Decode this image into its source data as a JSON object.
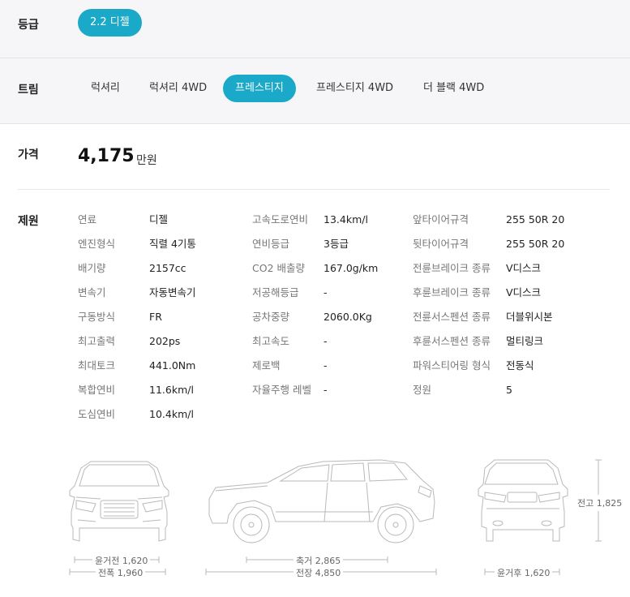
{
  "grade": {
    "label": "등급",
    "selected": "2.2 디젤"
  },
  "trim": {
    "label": "트림",
    "options": [
      "럭셔리",
      "럭셔리 4WD",
      "프레스티지",
      "프레스티지 4WD",
      "더 블랙 4WD"
    ],
    "selected": "프레스티지"
  },
  "price": {
    "label": "가격",
    "value": "4,175",
    "unit": "만원"
  },
  "specs": {
    "label": "제원",
    "col1": [
      {
        "key": "연료",
        "value": "디젤"
      },
      {
        "key": "엔진형식",
        "value": "직렬 4기통"
      },
      {
        "key": "배기량",
        "value": "2157cc"
      },
      {
        "key": "변속기",
        "value": "자동변속기"
      },
      {
        "key": "구동방식",
        "value": "FR"
      },
      {
        "key": "최고출력",
        "value": "202ps"
      },
      {
        "key": "최대토크",
        "value": "441.0Nm"
      },
      {
        "key": "복합연비",
        "value": "11.6km/l"
      },
      {
        "key": "도심연비",
        "value": "10.4km/l"
      }
    ],
    "col2": [
      {
        "key": "고속도로연비",
        "value": "13.4km/l"
      },
      {
        "key": "연비등급",
        "value": "3등급"
      },
      {
        "key": "CO2 배출량",
        "value": "167.0g/km"
      },
      {
        "key": "저공해등급",
        "value": "-"
      },
      {
        "key": "공차중량",
        "value": "2060.0Kg"
      },
      {
        "key": "최고속도",
        "value": "-"
      },
      {
        "key": "제로백",
        "value": "-"
      },
      {
        "key": "자율주행 레벨",
        "value": "-"
      }
    ],
    "col3": [
      {
        "key": "앞타이어규격",
        "value": "255 50R 20"
      },
      {
        "key": "뒷타이어규격",
        "value": "255 50R 20"
      },
      {
        "key": "전륜브레이크 종류",
        "value": "V디스크"
      },
      {
        "key": "후륜브레이크 종류",
        "value": "V디스크"
      },
      {
        "key": "전륜서스펜션 종류",
        "value": "더블위시본"
      },
      {
        "key": "후륜서스펜션 종류",
        "value": "멀티링크"
      },
      {
        "key": "파워스티어링 형식",
        "value": "전동식"
      },
      {
        "key": "정원",
        "value": "5"
      }
    ]
  },
  "dimensions": {
    "front_track": "윤거전 1,620",
    "width": "전폭 1,960",
    "wheelbase": "축거 2,865",
    "length": "전장 4,850",
    "height": "전고 1,825",
    "rear_track": "윤거후 1,620"
  },
  "colors": {
    "accent": "#1aa9c8",
    "band_bg": "#f6f6f8",
    "line": "#b9b9b9"
  }
}
